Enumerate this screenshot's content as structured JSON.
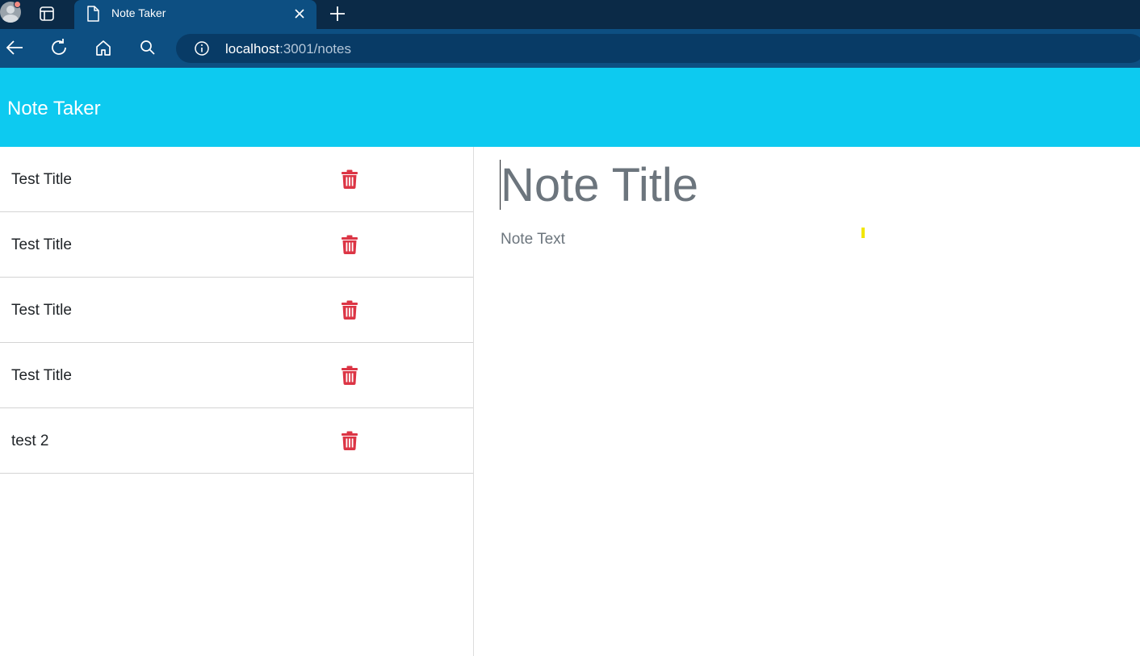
{
  "browser": {
    "tab_title": "Note Taker",
    "url_host": "localhost",
    "url_rest": ":3001/notes",
    "icons": [
      "profile-avatar",
      "tab-actions-icon",
      "page-icon",
      "close-icon",
      "plus-icon",
      "back-arrow-icon",
      "reload-icon",
      "home-icon",
      "search-icon",
      "info-icon"
    ]
  },
  "app": {
    "brand": "Note Taker",
    "accent_color": "#0dcaf0",
    "delete_color": "#dc3545"
  },
  "notes": [
    {
      "title": "Test Title"
    },
    {
      "title": "Test Title"
    },
    {
      "title": "Test Title"
    },
    {
      "title": "Test Title"
    },
    {
      "title": "test 2"
    }
  ],
  "editor": {
    "title_placeholder": "Note Title",
    "text_placeholder": "Note Text"
  }
}
